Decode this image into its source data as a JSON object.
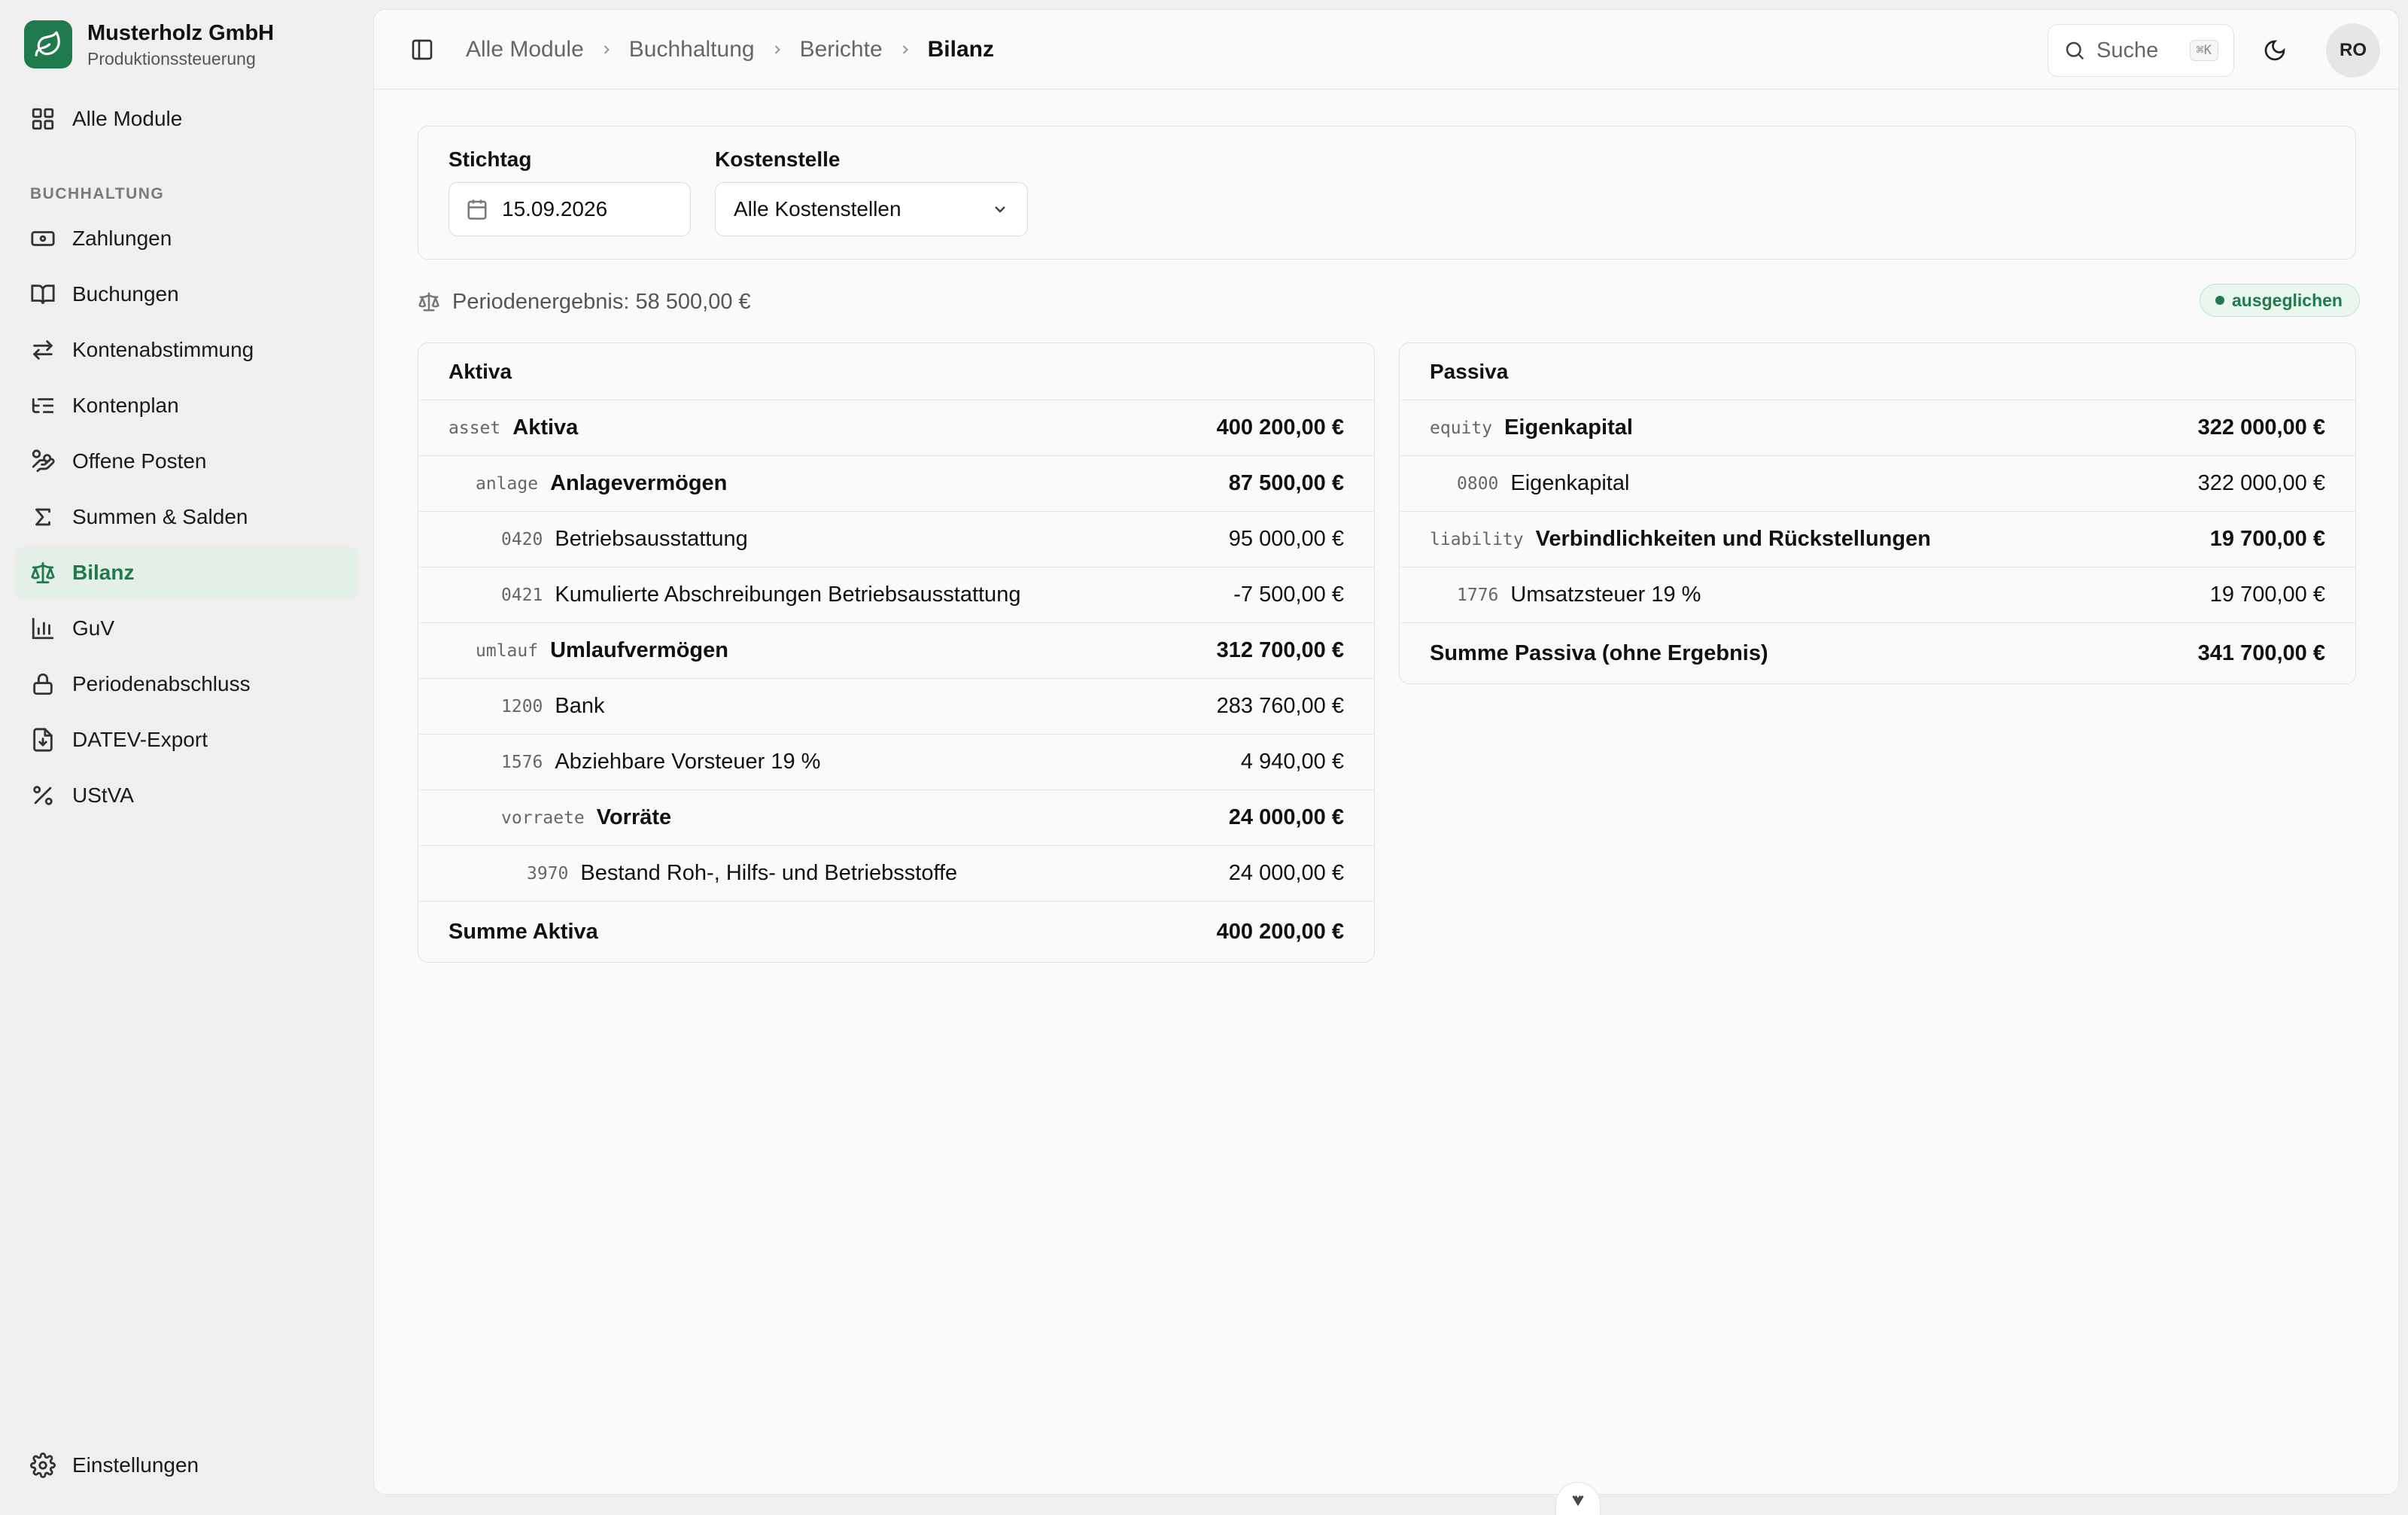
{
  "brand": {
    "name": "Musterholz GmbH",
    "subtitle": "Produktionssteuerung",
    "accent": "#1f7a4d"
  },
  "sidebar": {
    "top_item": {
      "label": "Alle Module",
      "icon": "grid-icon"
    },
    "section_label": "BUCHHALTUNG",
    "items": [
      {
        "label": "Zahlungen",
        "icon": "banknote-icon",
        "active": false
      },
      {
        "label": "Buchungen",
        "icon": "book-icon",
        "active": false
      },
      {
        "label": "Kontenabstimmung",
        "icon": "arrows-swap-icon",
        "active": false
      },
      {
        "label": "Kontenplan",
        "icon": "list-tree-icon",
        "active": false
      },
      {
        "label": "Offene Posten",
        "icon": "hand-coins-icon",
        "active": false
      },
      {
        "label": "Summen & Salden",
        "icon": "sigma-icon",
        "active": false
      },
      {
        "label": "Bilanz",
        "icon": "scale-icon",
        "active": true
      },
      {
        "label": "GuV",
        "icon": "bar-chart-icon",
        "active": false
      },
      {
        "label": "Periodenabschluss",
        "icon": "lock-icon",
        "active": false
      },
      {
        "label": "DATEV-Export",
        "icon": "file-download-icon",
        "active": false
      },
      {
        "label": "UStVA",
        "icon": "percent-icon",
        "active": false
      }
    ],
    "settings": {
      "label": "Einstellungen",
      "icon": "gear-icon"
    }
  },
  "header": {
    "breadcrumb": [
      "Alle Module",
      "Buchhaltung",
      "Berichte",
      "Bilanz"
    ],
    "search_label": "Suche",
    "search_shortcut": "⌘K",
    "avatar_initials": "RO"
  },
  "filters": {
    "date_label": "Stichtag",
    "date_value": "15.09.2026",
    "cost_center_label": "Kostenstelle",
    "cost_center_value": "Alle Kostenstellen"
  },
  "summary": {
    "result_text": "Periodenergebnis: 58 500,00 €",
    "status_badge": "ausgeglichen",
    "status_color": "#1f7a4d"
  },
  "aktiva": {
    "title": "Aktiva",
    "rows": [
      {
        "code": "asset",
        "name": "Aktiva",
        "amount": "400 200,00 €"
      },
      {
        "code": "anlage",
        "name": "Anlagevermögen",
        "amount": "87 500,00 €"
      },
      {
        "code": "0420",
        "name": "Betriebsausstattung",
        "amount": "95 000,00 €"
      },
      {
        "code": "0421",
        "name": "Kumulierte Abschreibungen Betriebsausstattung",
        "amount": "-7 500,00 €"
      },
      {
        "code": "umlauf",
        "name": "Umlaufvermögen",
        "amount": "312 700,00 €"
      },
      {
        "code": "1200",
        "name": "Bank",
        "amount": "283 760,00 €"
      },
      {
        "code": "1576",
        "name": "Abziehbare Vorsteuer 19 %",
        "amount": "4 940,00 €"
      },
      {
        "code": "vorraete",
        "name": "Vorräte",
        "amount": "24 000,00 €"
      },
      {
        "code": "3970",
        "name": "Bestand Roh-, Hilfs- und Betriebsstoffe",
        "amount": "24 000,00 €"
      }
    ],
    "total_label": "Summe Aktiva",
    "total_amount": "400 200,00 €"
  },
  "passiva": {
    "title": "Passiva",
    "rows": [
      {
        "code": "equity",
        "name": "Eigenkapital",
        "amount": "322 000,00 €"
      },
      {
        "code": "0800",
        "name": "Eigenkapital",
        "amount": "322 000,00 €"
      },
      {
        "code": "liability",
        "name": "Verbindlichkeiten und Rückstellungen",
        "amount": "19 700,00 €"
      },
      {
        "code": "1776",
        "name": "Umsatzsteuer 19 %",
        "amount": "19 700,00 €"
      }
    ],
    "total_label": "Summe Passiva (ohne Ergebnis)",
    "total_amount": "341 700,00 €"
  }
}
